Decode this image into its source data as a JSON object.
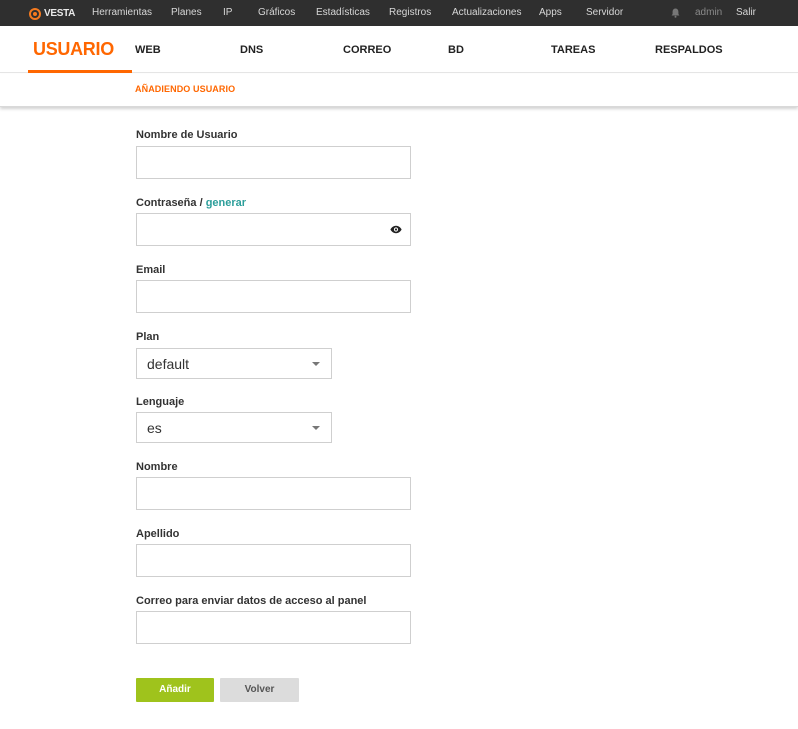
{
  "topbar": {
    "logo_text": "VESTA",
    "nav": [
      "Herramientas",
      "Planes",
      "IP",
      "Gráficos",
      "Estadísticas",
      "Registros",
      "Actualizaciones",
      "Apps",
      "Servidor"
    ],
    "user": "admin",
    "logout": "Salir"
  },
  "tabs": {
    "active": "USUARIO",
    "items": [
      "WEB",
      "DNS",
      "CORREO",
      "BD",
      "TAREAS",
      "RESPALDOS"
    ]
  },
  "subtitle": "AÑADIENDO USUARIO",
  "form": {
    "username_label": "Nombre de Usuario",
    "username_value": "",
    "password_label": "Contraseña",
    "password_sep": " / ",
    "password_generate": "generar",
    "password_value": "",
    "email_label": "Email",
    "email_value": "",
    "plan_label": "Plan",
    "plan_value": "default",
    "language_label": "Lenguaje",
    "language_value": "es",
    "firstname_label": "Nombre",
    "firstname_value": "",
    "lastname_label": "Apellido",
    "lastname_value": "",
    "notify_label": "Correo para enviar datos de acceso al panel",
    "notify_value": ""
  },
  "buttons": {
    "add": "Añadir",
    "back": "Volver"
  },
  "colors": {
    "accent": "#ff6701",
    "link": "#2c9e9a",
    "add_button": "#9fc31c",
    "topbar": "#2f2f2f"
  }
}
